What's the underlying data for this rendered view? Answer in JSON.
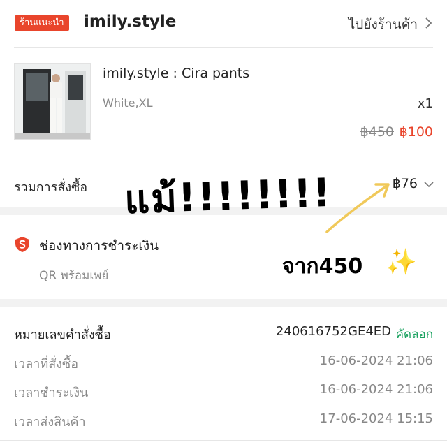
{
  "shop": {
    "badge": "ร้านแนะนำ",
    "name": "imily.style",
    "go_to_shop": "ไปยังร้านค้า"
  },
  "product": {
    "title": "imily.style : Cira pants",
    "variant": "White,XL",
    "quantity": "x1",
    "original_price": "฿450",
    "price": "฿100"
  },
  "total": {
    "label": "รวมการสั่งซื้อ",
    "value": "฿76"
  },
  "payment": {
    "title": "ช่องทางการชำระเงิน",
    "method": "QR พร้อมเพย์"
  },
  "order": {
    "number_label": "หมายเลขคำสั่งซื้อ",
    "number": "240616752GE4ED",
    "copy_label": "คัดลอก",
    "rows": [
      {
        "label": "เวลาที่สั่งซื้อ",
        "value": "16-06-2024 21:06"
      },
      {
        "label": "เวลาชำระเงิน",
        "value": "16-06-2024 21:06"
      },
      {
        "label": "เวลาส่งสินค้า",
        "value": "17-06-2024 15:15"
      }
    ]
  },
  "overlay": {
    "big_text": "แม้!!!!!!!!",
    "small_text": "จาก450",
    "sparkle": "✨"
  },
  "colors": {
    "accent": "#e9452c",
    "copy_link": "#1aa260",
    "sparkle": "#f6c21a"
  },
  "icons": [
    "chevron-right-icon",
    "chevron-down-icon",
    "shield-icon",
    "sparkles-icon",
    "arrow-icon"
  ]
}
